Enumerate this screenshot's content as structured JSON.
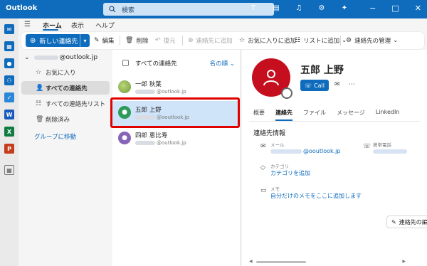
{
  "colors": {
    "accent": "#0f6cbd",
    "avatar_red": "#c50f1f",
    "selection": "#cfe4f8",
    "highlight": "#e00000"
  },
  "titlebar": {
    "app_title": "Outlook",
    "search_placeholder": "検索",
    "icons": [
      "teams-icon",
      "calendar-note-icon",
      "bell-icon",
      "gear-icon",
      "lightbulb-icon"
    ],
    "window_controls": [
      "minimize",
      "maximize",
      "close"
    ]
  },
  "menu": {
    "tabs": [
      "ホーム",
      "表示",
      "ヘルプ"
    ],
    "active": "ホーム"
  },
  "ribbon": {
    "new_contact": "新しい連絡先",
    "edit": "編集",
    "delete": "削除",
    "restore": "復元",
    "add_to_contacts": "連絡先に追加",
    "add_to_favorites": "お気に入りに追加",
    "add_to_list": "リストに追加",
    "manage_contacts": "連絡先の管理"
  },
  "folders": {
    "account_suffix": "@outlook.jp",
    "items": [
      {
        "label": "お気に入り",
        "icon": "star-icon"
      },
      {
        "label": "すべての連絡先",
        "icon": "people-icon",
        "active": true
      },
      {
        "label": "すべての連絡先リスト",
        "icon": "people-list-icon"
      },
      {
        "label": "削除済み",
        "icon": "trash-icon"
      }
    ],
    "goto_groups": "グループに移動"
  },
  "contact_list": {
    "title": "すべての連絡先",
    "sort": "名の順",
    "contacts": [
      {
        "name": "一郎 秋葉",
        "email_suffix": "@outlook.jp",
        "avatar": "photo"
      },
      {
        "name": "五郎 上野",
        "email_suffix": "@ooutlook.jp",
        "avatar": "person",
        "selected": true
      },
      {
        "name": "四郎 恵比寿",
        "email_suffix": "@outlook.jp",
        "avatar": "person"
      }
    ]
  },
  "detail": {
    "name": "五郎 上野",
    "call": "Call",
    "tabs": [
      "概要",
      "連絡先",
      "ファイル",
      "メッセージ",
      "LinkedIn"
    ],
    "active_tab": "連絡先",
    "section_title": "連絡先情報",
    "email_label": "メール",
    "email_suffix": "@ooutlook.jp",
    "phone_label": "携帯電話",
    "category_label": "カテゴリ",
    "category_action": "カテゴリを追加",
    "memo_label": "メモ",
    "memo_action": "自分だけのメモをここに追加します",
    "edit_contact": "連絡先の編"
  }
}
